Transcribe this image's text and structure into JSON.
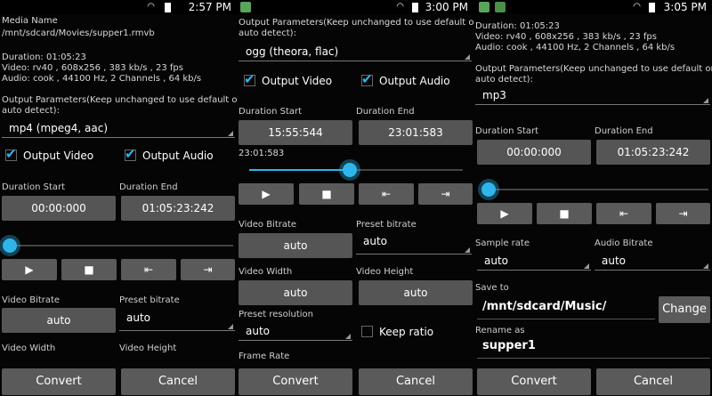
{
  "panel1": {
    "status_time": "2:57 PM",
    "media_name_label": "Media Name",
    "media_path": "/mnt/sdcard/Movies/supper1.rmvb",
    "duration_line": "Duration: 01:05:23",
    "video_line": "Video: rv40 , 608x256 , 383 kb/s , 23 fps",
    "audio_line": "Audio: cook , 44100 Hz, 2 Channels , 64 kb/s",
    "output_params_label_1": "Output Parameters(Keep unchanged to use default or",
    "output_params_label_2": "auto detect):",
    "format_value": "mp4 (mpeg4, aac)",
    "output_video_label": "Output Video",
    "output_audio_label": "Output Audio",
    "duration_start_label": "Duration Start",
    "duration_end_label": "Duration End",
    "duration_start_value": "00:00:000",
    "duration_end_value": "01:05:23:242",
    "seek_progress": 0.02,
    "video_bitrate_label": "Video Bitrate",
    "preset_bitrate_label": "Preset bitrate",
    "video_bitrate_value": "auto",
    "preset_bitrate_value": "auto",
    "video_width_label": "Video Width",
    "video_height_label": "Video Height",
    "convert_label": "Convert",
    "cancel_label": "Cancel"
  },
  "panel2": {
    "status_time": "3:00 PM",
    "output_params_label_1": "Output Parameters(Keep unchanged to use default or",
    "output_params_label_2": "auto detect):",
    "format_value": "ogg (theora, flac)",
    "output_video_label": "Output Video",
    "output_audio_label": "Output Audio",
    "duration_start_label": "Duration Start",
    "duration_end_label": "Duration End",
    "duration_start_value": "15:55:544",
    "duration_end_value": "23:01:583",
    "seek_time": "23:01:583",
    "seek_progress": 0.47,
    "video_bitrate_label": "Video Bitrate",
    "preset_bitrate_label": "Preset bitrate",
    "video_bitrate_value": "auto",
    "preset_bitrate_value": "auto",
    "video_width_label": "Video Width",
    "video_height_label": "Video Height",
    "video_width_value": "auto",
    "video_height_value": "auto",
    "preset_resolution_label": "Preset resolution",
    "preset_resolution_value": "auto",
    "keep_ratio_label": "Keep ratio",
    "frame_rate_label": "Frame Rate",
    "convert_label": "Convert",
    "cancel_label": "Cancel"
  },
  "panel3": {
    "status_time": "3:05 PM",
    "duration_line": "Duration: 01:05:23",
    "video_line": "Video: rv40 , 608x256 , 383 kb/s , 23 fps",
    "audio_line": "Audio: cook , 44100 Hz, 2 Channels , 64 kb/s",
    "output_params_label_1": "Output Parameters(Keep unchanged to use default or",
    "output_params_label_2": "auto detect):",
    "format_value": "mp3",
    "duration_start_label": "Duration Start",
    "duration_end_label": "Duration End",
    "duration_start_value": "00:00:000",
    "duration_end_value": "01:05:23:242",
    "seek_progress": 0.02,
    "sample_rate_label": "Sample rate",
    "audio_bitrate_label": "Audio Bitrate",
    "sample_rate_value": "auto",
    "audio_bitrate_value": "auto",
    "save_to_label": "Save to",
    "save_to_value": "/mnt/sdcard/Music/",
    "change_label": "Change",
    "rename_as_label": "Rename as",
    "rename_as_value": "supper1",
    "convert_label": "Convert",
    "cancel_label": "Cancel"
  },
  "icons": {
    "play": "▶",
    "stop": "■",
    "prev": "⇤",
    "next": "⇥",
    "check": "✔"
  },
  "colors": {
    "accent": "#2fb5ea",
    "button": "#5a5a5a",
    "background": "#050505"
  }
}
